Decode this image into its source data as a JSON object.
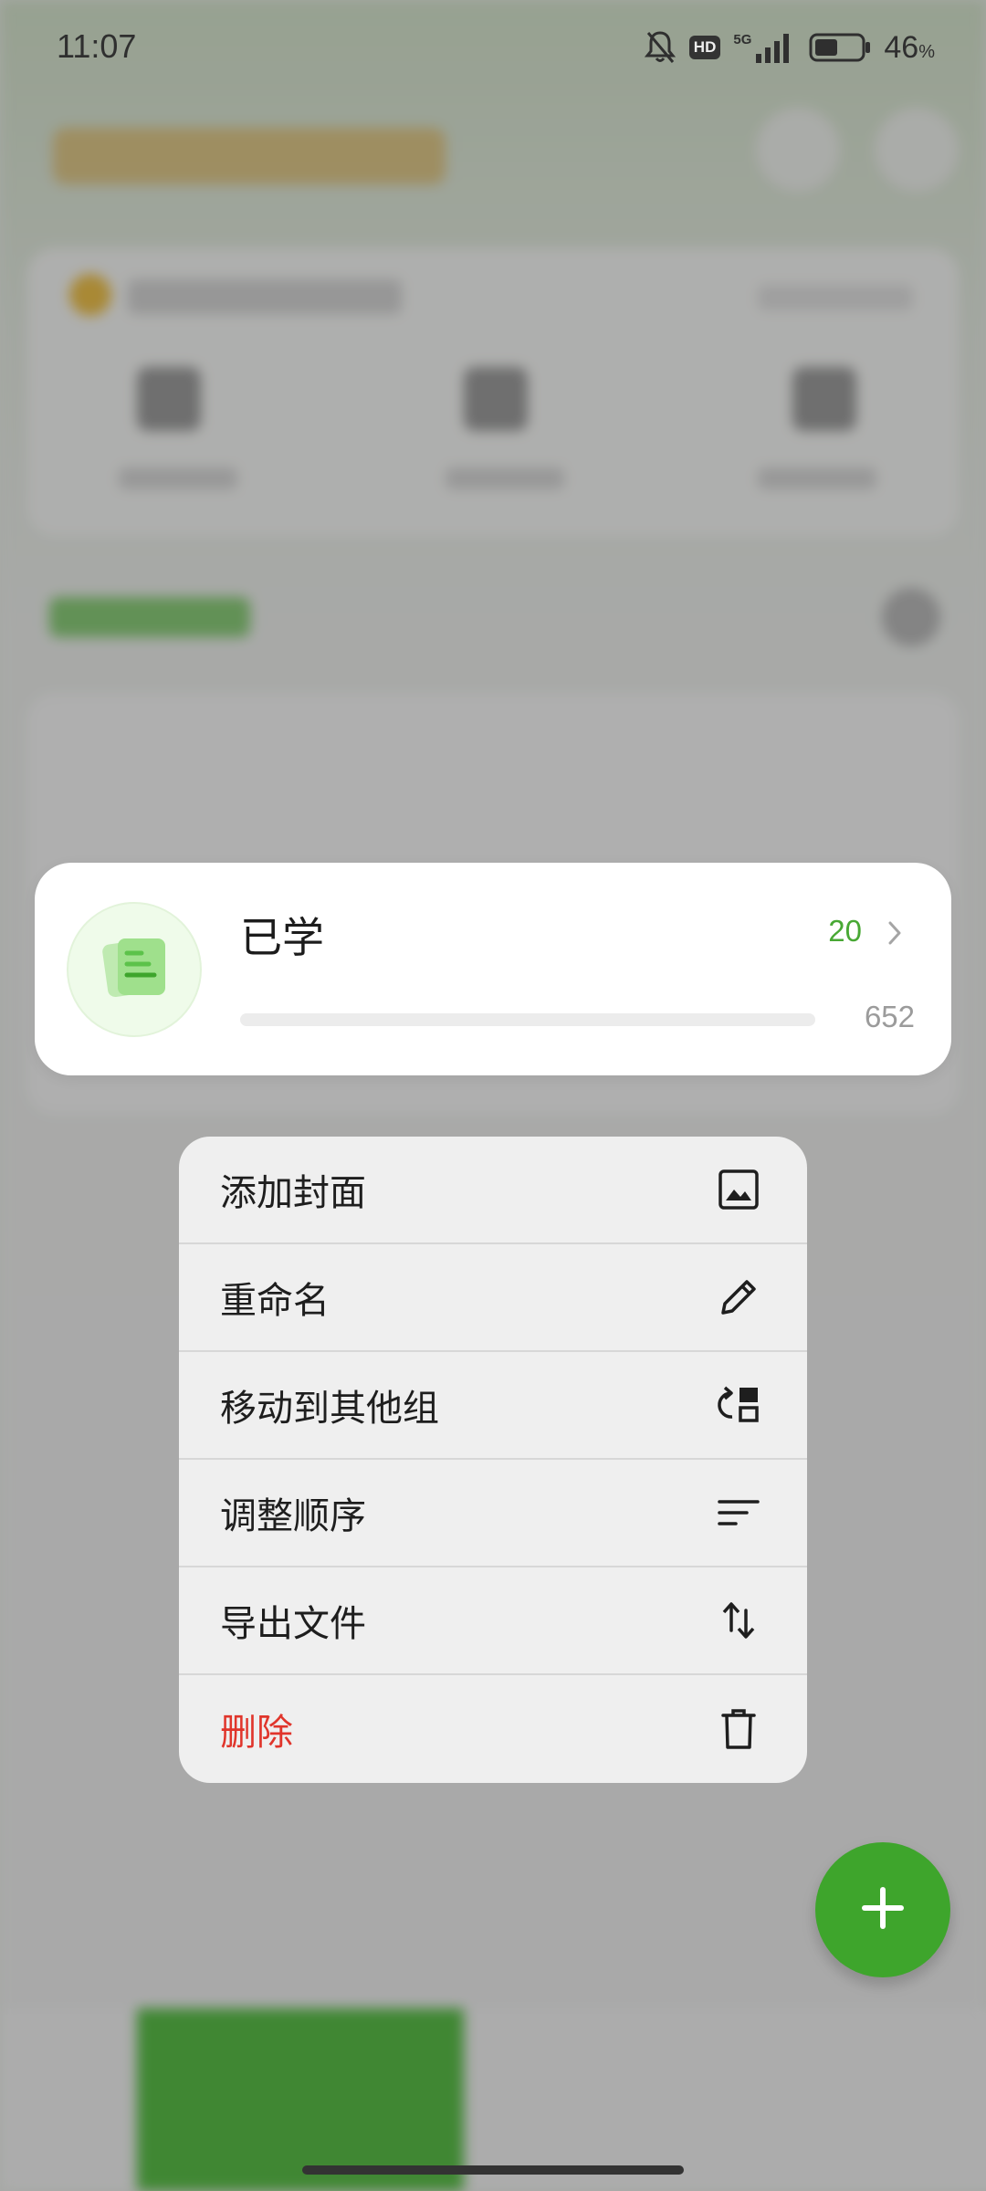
{
  "status_bar": {
    "time": "11:07",
    "network": "5G",
    "battery_percent": "46",
    "battery_unit": "%",
    "hd_label": "HD"
  },
  "item_card": {
    "title": "已学",
    "count": "20",
    "total": "652",
    "progress_fraction": 0.0,
    "accent_color": "#48a834",
    "thumbnail_icon": "flashcards-stack-icon",
    "chevron_icon": "chevron-right-icon"
  },
  "context_menu": {
    "items": [
      {
        "label": "添加封面",
        "icon": "image-icon",
        "danger": false
      },
      {
        "label": "重命名",
        "icon": "pencil-icon",
        "danger": false
      },
      {
        "label": "移动到其他组",
        "icon": "move-group-icon",
        "danger": false
      },
      {
        "label": "调整顺序",
        "icon": "sort-lines-icon",
        "danger": false
      },
      {
        "label": "导出文件",
        "icon": "transfer-arrows-icon",
        "danger": false
      },
      {
        "label": "删除",
        "icon": "trash-icon",
        "danger": true
      }
    ],
    "danger_color": "#e0352b"
  },
  "fab": {
    "icon": "plus-icon",
    "color": "#3ea52c"
  }
}
